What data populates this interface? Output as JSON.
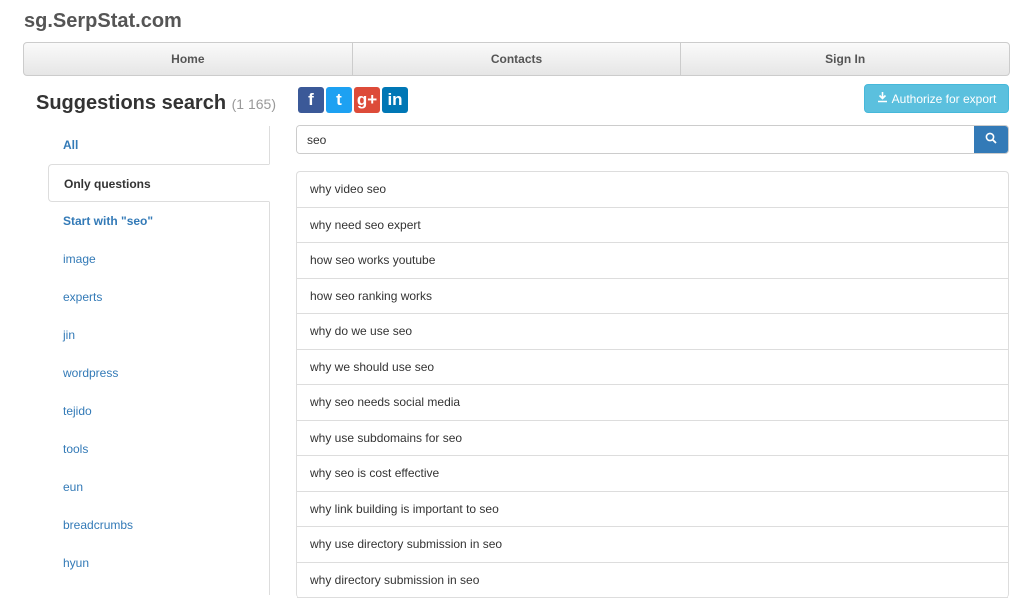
{
  "brand": "sg.SerpStat.com",
  "nav": [
    "Home",
    "Contacts",
    "Sign In"
  ],
  "title": {
    "text": "Suggestions search",
    "count": "(1 165)"
  },
  "sidebar": {
    "items": [
      {
        "label": "All",
        "bold": true,
        "active": false
      },
      {
        "label": "Only questions",
        "bold": true,
        "active": true
      },
      {
        "label": "Start with \"seo\"",
        "bold": true,
        "active": false
      },
      {
        "label": "image"
      },
      {
        "label": "experts"
      },
      {
        "label": "jin"
      },
      {
        "label": "wordpress"
      },
      {
        "label": "tejido"
      },
      {
        "label": "tools"
      },
      {
        "label": "eun"
      },
      {
        "label": "breadcrumbs"
      },
      {
        "label": "hyun"
      }
    ]
  },
  "social": [
    {
      "icon": "facebook-icon",
      "glyph": "f",
      "color": "#3b5998"
    },
    {
      "icon": "twitter-icon",
      "glyph": "t",
      "color": "#1da1f2"
    },
    {
      "icon": "google-plus-icon",
      "glyph": "g+",
      "color": "#dd4b39"
    },
    {
      "icon": "linkedin-icon",
      "glyph": "in",
      "color": "#0077b5"
    }
  ],
  "export": {
    "label": "Authorize for export",
    "icon": "download-icon"
  },
  "search": {
    "value": "seo"
  },
  "results": [
    "why video seo",
    "why need seo expert",
    "how seo works youtube",
    "how seo ranking works",
    "why do we use seo",
    "why we should use seo",
    "why seo needs social media",
    "why use subdomains for seo",
    "why seo is cost effective",
    "why link building is important to seo",
    "why use directory submission in seo",
    "why directory submission in seo"
  ],
  "colors": {
    "accent": "#337ab7",
    "info": "#5bc0de"
  }
}
